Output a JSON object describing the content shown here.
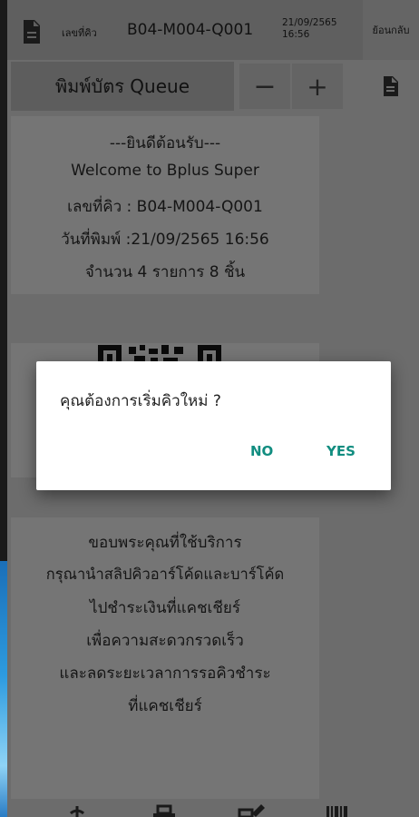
{
  "header": {
    "queue_label": "เลขที่คิว",
    "queue_number": "B04-M004-Q001",
    "date": "21/09/2565",
    "time": "16:56",
    "back_label": "ย้อนกลับ"
  },
  "toolbar": {
    "print_label": "พิมพ์บัตร Queue",
    "minus_label": "−",
    "plus_label": "+"
  },
  "receipt": {
    "header_lines": [
      "---ยินดีต้อนรับ---",
      "Welcome to Bplus Super",
      "เลขที่คิว : B04-M004-Q001",
      "วันที่พิมพ์ :21/09/2565 16:56",
      "จำนวน 4 รายการ 8 ชิ้น"
    ],
    "footer_lines": [
      "ขอบพระคุณที่ใช้บริการ",
      "กรุณานำสลิปคิวอาร์โค้ดและบาร์โค้ด",
      "ไปชำระเงินที่แคชเชียร์",
      "เพื่อความสะดวกรวดเร็ว",
      "และลดระยะเวลาการรอคิวชำระ",
      "ที่แคชเชียร์"
    ]
  },
  "dialog": {
    "message": "คุณต้องการเริ่มคิวใหม่ ?",
    "no_label": "NO",
    "yes_label": "YES"
  },
  "icons": [
    "document-icon",
    "document-icon",
    "power-icon",
    "print-icon",
    "edit-icon",
    "barcode-icon"
  ],
  "colors": {
    "accent": "#118d80",
    "dialog_bg": "#ffffff"
  }
}
